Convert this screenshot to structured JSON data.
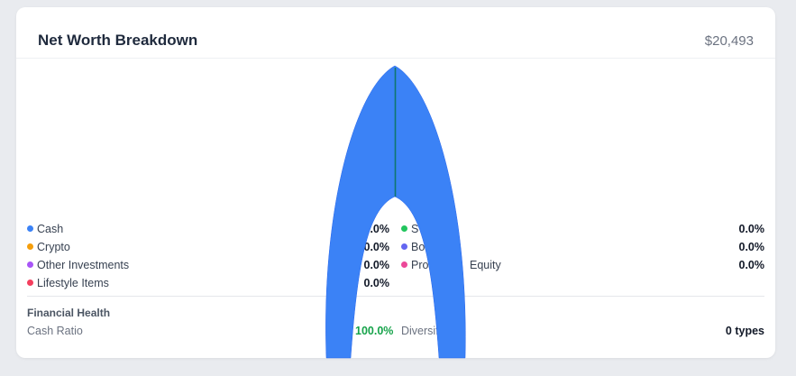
{
  "header": {
    "title": "Net Worth Breakdown",
    "total": "$20,493"
  },
  "legend": [
    {
      "label": "Cash",
      "percent": "0.0%",
      "color": "#3b82f6"
    },
    {
      "label": "S",
      "percent": "0.0%",
      "color": "#22c55e"
    },
    {
      "label": "Crypto",
      "percent": "0.0%",
      "color": "#f59e0b"
    },
    {
      "label": "Bo",
      "percent": "0.0%",
      "color": "#6366f1"
    },
    {
      "label": "Other Investments",
      "percent": "0.0%",
      "color": "#a855f7"
    },
    {
      "label": "Pro",
      "label_tail": "Equity",
      "percent": "0.0%",
      "color": "#ec4899"
    },
    {
      "label": "Lifestyle Items",
      "percent": "0.0%",
      "color": "#f43f5e"
    }
  ],
  "financial_health": {
    "title": "Financial Health",
    "cash_ratio_label": "Cash Ratio",
    "cash_ratio_value": "100.0%",
    "cash_ratio_color": "#16a34a",
    "diversification_label": "Diversif",
    "diversification_label_tail": "n",
    "diversification_value": "0 types"
  },
  "colors": {
    "chart_fill": "#3b82f6",
    "chart_centerline": "#0f766e"
  }
}
